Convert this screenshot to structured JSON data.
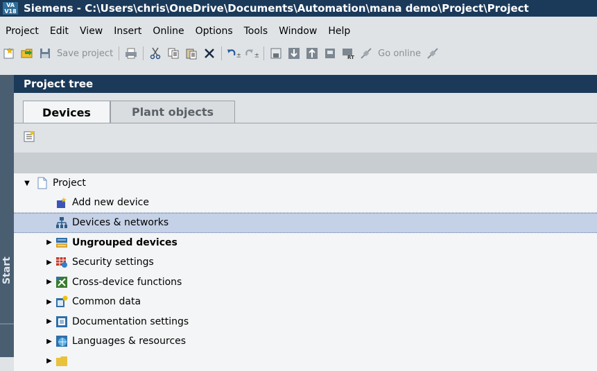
{
  "window": {
    "app_logo": "VA V18",
    "title": "Siemens  -  C:\\Users\\chris\\OneDrive\\Documents\\Automation\\mana demo\\Project\\Project"
  },
  "menu": [
    "Project",
    "Edit",
    "View",
    "Insert",
    "Online",
    "Options",
    "Tools",
    "Window",
    "Help"
  ],
  "toolbar": {
    "save_label": "Save project",
    "go_online_label": "Go online"
  },
  "sidebar": {
    "start_label": "Start"
  },
  "panel": {
    "title": "Project tree",
    "tabs": [
      {
        "label": "Devices",
        "active": true
      },
      {
        "label": "Plant objects",
        "active": false
      }
    ]
  },
  "tree": [
    {
      "label": "Project",
      "icon": "project-icon",
      "expanded": true,
      "bold": false
    },
    {
      "label": "Add new device",
      "icon": "add-device-icon",
      "bold": false
    },
    {
      "label": "Devices & networks",
      "icon": "network-icon",
      "bold": false,
      "selected": true
    },
    {
      "label": "Ungrouped devices",
      "icon": "ungrouped-devices-icon",
      "bold": true
    },
    {
      "label": "Security settings",
      "icon": "security-icon",
      "bold": false
    },
    {
      "label": "Cross-device functions",
      "icon": "cross-device-icon",
      "bold": false
    },
    {
      "label": "Common data",
      "icon": "common-data-icon",
      "bold": false
    },
    {
      "label": "Documentation settings",
      "icon": "documentation-icon",
      "bold": false
    },
    {
      "label": "Languages & resources",
      "icon": "languages-icon",
      "bold": false
    }
  ],
  "colors": {
    "title_bar": "#1b3a5a",
    "selection": "#c4d1e6",
    "sidebar": "#4a5e72"
  }
}
